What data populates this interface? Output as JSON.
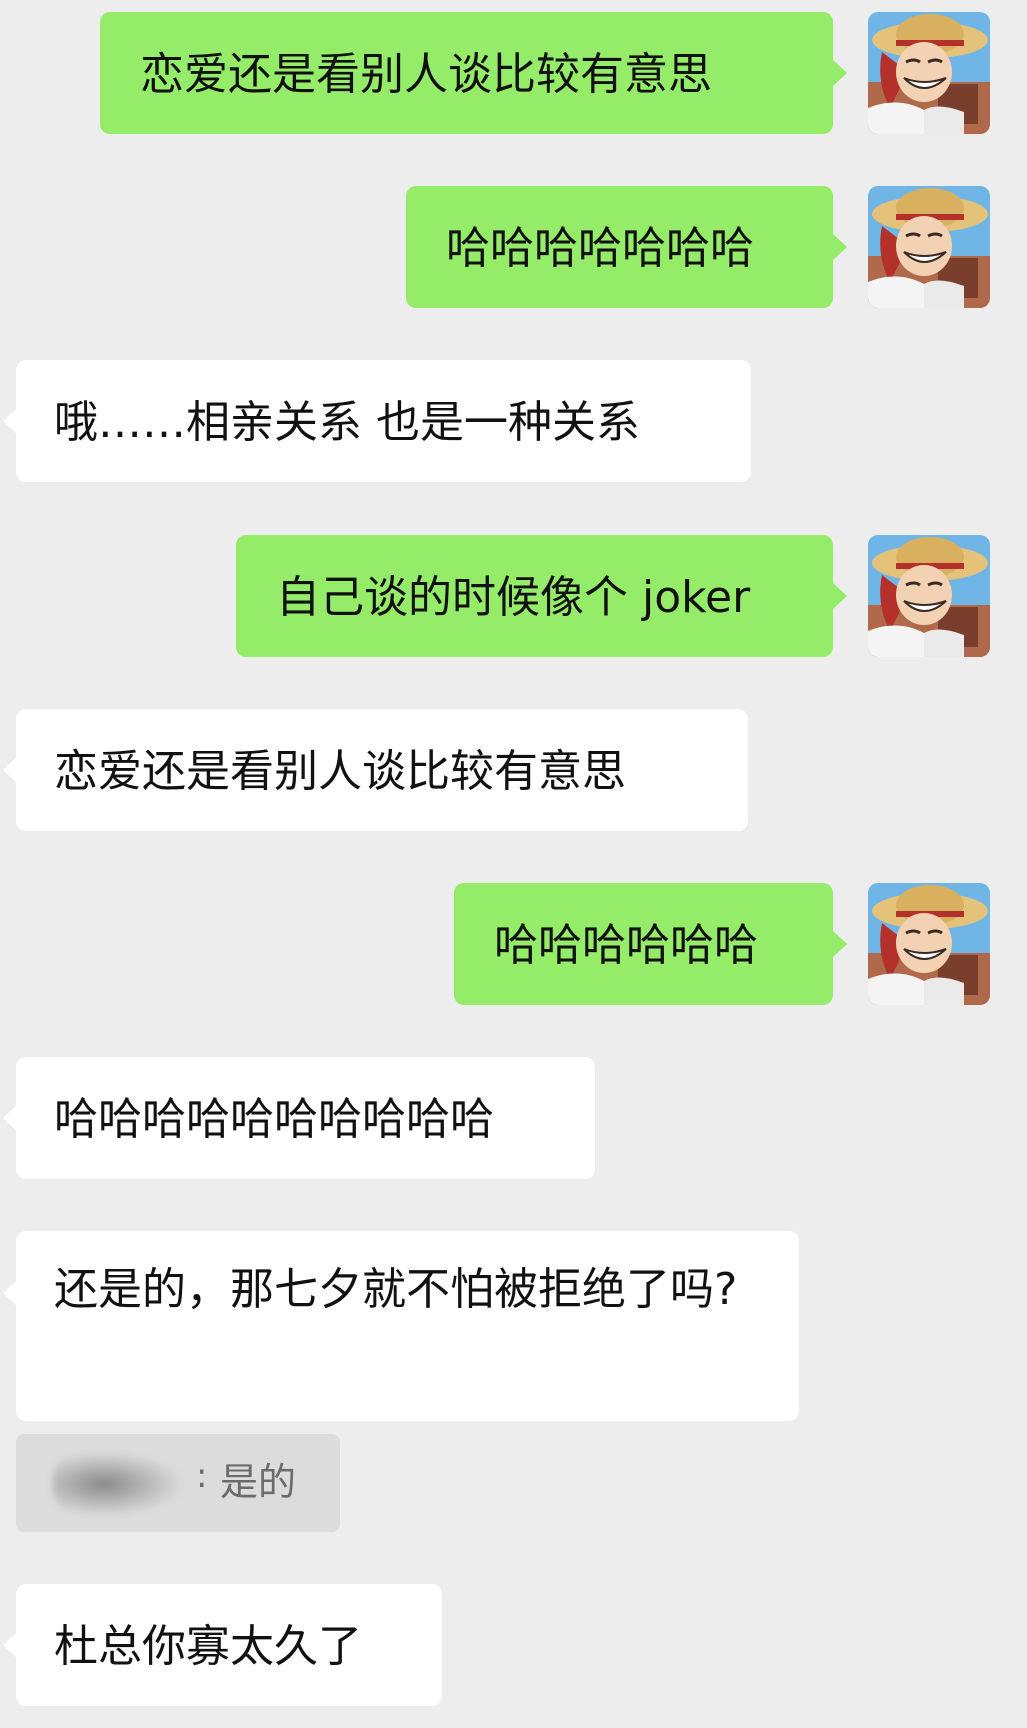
{
  "messages": [
    {
      "side": "out",
      "text": "恋爱还是看别人谈比较有意思"
    },
    {
      "side": "out",
      "text": "哈哈哈哈哈哈哈"
    },
    {
      "side": "in",
      "text": "哦……相亲关系  也是一种关系"
    },
    {
      "side": "out",
      "text": "自己谈的时候像个 joker"
    },
    {
      "side": "in",
      "text": "恋爱还是看别人谈比较有意思"
    },
    {
      "side": "out",
      "text": "哈哈哈哈哈哈"
    },
    {
      "side": "in",
      "text": "哈哈哈哈哈哈哈哈哈哈"
    },
    {
      "side": "in",
      "text": "还是的，那七夕就不怕被拒绝了吗?"
    },
    {
      "side": "in",
      "text": "杜总你寡太久了"
    }
  ],
  "quote": {
    "colon": ":",
    "text": "是的"
  },
  "colors": {
    "outgoing_bubble": "#95ec69",
    "incoming_bubble": "#ffffff",
    "background": "#ededed",
    "quote_bg": "#dcdcdc"
  },
  "avatar_icon": "anime-straw-hat-avatar-icon"
}
